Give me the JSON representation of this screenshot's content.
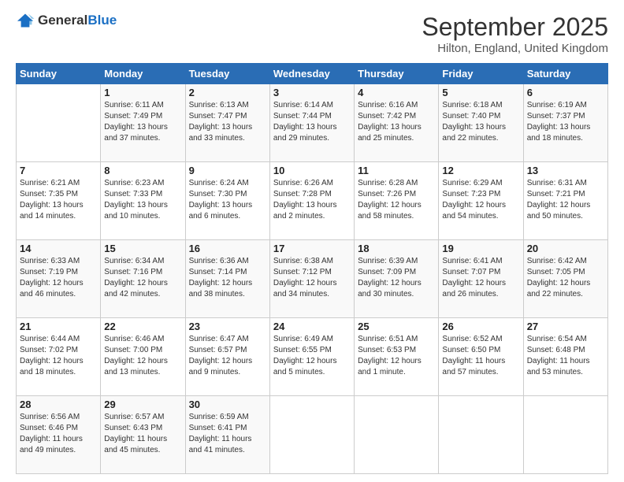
{
  "logo": {
    "general": "General",
    "blue": "Blue"
  },
  "header": {
    "month": "September 2025",
    "location": "Hilton, England, United Kingdom"
  },
  "weekdays": [
    "Sunday",
    "Monday",
    "Tuesday",
    "Wednesday",
    "Thursday",
    "Friday",
    "Saturday"
  ],
  "weeks": [
    [
      {
        "day": "",
        "info": ""
      },
      {
        "day": "1",
        "info": "Sunrise: 6:11 AM\nSunset: 7:49 PM\nDaylight: 13 hours\nand 37 minutes."
      },
      {
        "day": "2",
        "info": "Sunrise: 6:13 AM\nSunset: 7:47 PM\nDaylight: 13 hours\nand 33 minutes."
      },
      {
        "day": "3",
        "info": "Sunrise: 6:14 AM\nSunset: 7:44 PM\nDaylight: 13 hours\nand 29 minutes."
      },
      {
        "day": "4",
        "info": "Sunrise: 6:16 AM\nSunset: 7:42 PM\nDaylight: 13 hours\nand 25 minutes."
      },
      {
        "day": "5",
        "info": "Sunrise: 6:18 AM\nSunset: 7:40 PM\nDaylight: 13 hours\nand 22 minutes."
      },
      {
        "day": "6",
        "info": "Sunrise: 6:19 AM\nSunset: 7:37 PM\nDaylight: 13 hours\nand 18 minutes."
      }
    ],
    [
      {
        "day": "7",
        "info": "Sunrise: 6:21 AM\nSunset: 7:35 PM\nDaylight: 13 hours\nand 14 minutes."
      },
      {
        "day": "8",
        "info": "Sunrise: 6:23 AM\nSunset: 7:33 PM\nDaylight: 13 hours\nand 10 minutes."
      },
      {
        "day": "9",
        "info": "Sunrise: 6:24 AM\nSunset: 7:30 PM\nDaylight: 13 hours\nand 6 minutes."
      },
      {
        "day": "10",
        "info": "Sunrise: 6:26 AM\nSunset: 7:28 PM\nDaylight: 13 hours\nand 2 minutes."
      },
      {
        "day": "11",
        "info": "Sunrise: 6:28 AM\nSunset: 7:26 PM\nDaylight: 12 hours\nand 58 minutes."
      },
      {
        "day": "12",
        "info": "Sunrise: 6:29 AM\nSunset: 7:23 PM\nDaylight: 12 hours\nand 54 minutes."
      },
      {
        "day": "13",
        "info": "Sunrise: 6:31 AM\nSunset: 7:21 PM\nDaylight: 12 hours\nand 50 minutes."
      }
    ],
    [
      {
        "day": "14",
        "info": "Sunrise: 6:33 AM\nSunset: 7:19 PM\nDaylight: 12 hours\nand 46 minutes."
      },
      {
        "day": "15",
        "info": "Sunrise: 6:34 AM\nSunset: 7:16 PM\nDaylight: 12 hours\nand 42 minutes."
      },
      {
        "day": "16",
        "info": "Sunrise: 6:36 AM\nSunset: 7:14 PM\nDaylight: 12 hours\nand 38 minutes."
      },
      {
        "day": "17",
        "info": "Sunrise: 6:38 AM\nSunset: 7:12 PM\nDaylight: 12 hours\nand 34 minutes."
      },
      {
        "day": "18",
        "info": "Sunrise: 6:39 AM\nSunset: 7:09 PM\nDaylight: 12 hours\nand 30 minutes."
      },
      {
        "day": "19",
        "info": "Sunrise: 6:41 AM\nSunset: 7:07 PM\nDaylight: 12 hours\nand 26 minutes."
      },
      {
        "day": "20",
        "info": "Sunrise: 6:42 AM\nSunset: 7:05 PM\nDaylight: 12 hours\nand 22 minutes."
      }
    ],
    [
      {
        "day": "21",
        "info": "Sunrise: 6:44 AM\nSunset: 7:02 PM\nDaylight: 12 hours\nand 18 minutes."
      },
      {
        "day": "22",
        "info": "Sunrise: 6:46 AM\nSunset: 7:00 PM\nDaylight: 12 hours\nand 13 minutes."
      },
      {
        "day": "23",
        "info": "Sunrise: 6:47 AM\nSunset: 6:57 PM\nDaylight: 12 hours\nand 9 minutes."
      },
      {
        "day": "24",
        "info": "Sunrise: 6:49 AM\nSunset: 6:55 PM\nDaylight: 12 hours\nand 5 minutes."
      },
      {
        "day": "25",
        "info": "Sunrise: 6:51 AM\nSunset: 6:53 PM\nDaylight: 12 hours\nand 1 minute."
      },
      {
        "day": "26",
        "info": "Sunrise: 6:52 AM\nSunset: 6:50 PM\nDaylight: 11 hours\nand 57 minutes."
      },
      {
        "day": "27",
        "info": "Sunrise: 6:54 AM\nSunset: 6:48 PM\nDaylight: 11 hours\nand 53 minutes."
      }
    ],
    [
      {
        "day": "28",
        "info": "Sunrise: 6:56 AM\nSunset: 6:46 PM\nDaylight: 11 hours\nand 49 minutes."
      },
      {
        "day": "29",
        "info": "Sunrise: 6:57 AM\nSunset: 6:43 PM\nDaylight: 11 hours\nand 45 minutes."
      },
      {
        "day": "30",
        "info": "Sunrise: 6:59 AM\nSunset: 6:41 PM\nDaylight: 11 hours\nand 41 minutes."
      },
      {
        "day": "",
        "info": ""
      },
      {
        "day": "",
        "info": ""
      },
      {
        "day": "",
        "info": ""
      },
      {
        "day": "",
        "info": ""
      }
    ]
  ]
}
